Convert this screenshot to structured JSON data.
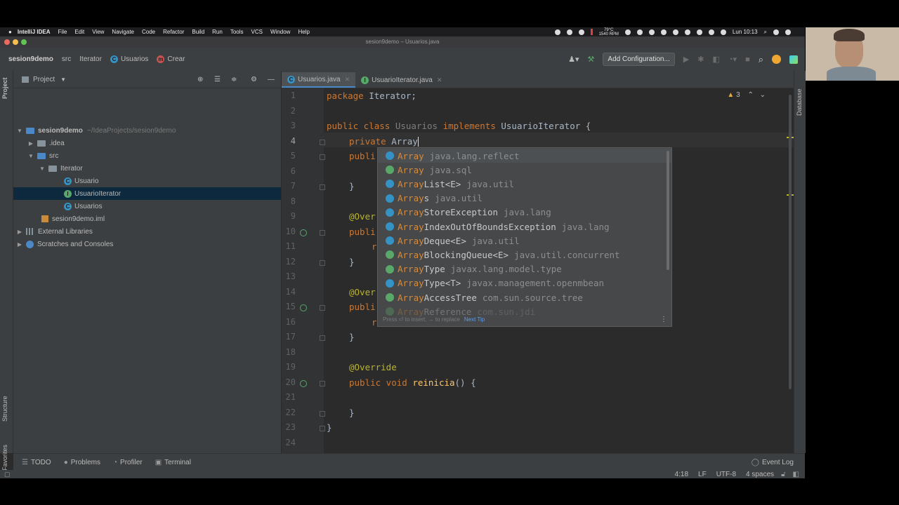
{
  "colors": {
    "background": "#2b2b2b",
    "accent": "#4a88c7",
    "selection": "#0d293e",
    "keyword": "#cc7832",
    "annotation": "#bbb529",
    "function": "#ffc66d"
  },
  "menubar": {
    "app": "IntelliJ IDEA",
    "items": [
      "File",
      "Edit",
      "View",
      "Navigate",
      "Code",
      "Refactor",
      "Build",
      "Run",
      "Tools",
      "VCS",
      "Window",
      "Help"
    ],
    "clock": "Lun 10:13",
    "weather": "79°C",
    "fan": "1540 RPM"
  },
  "window": {
    "title": "sesion9demo – Usuarios.java"
  },
  "navbar": {
    "project": "sesion9demo",
    "src": "src",
    "package": "Iterator",
    "class": "Usuarios",
    "method": "Crear",
    "add_configuration": "Add Configuration..."
  },
  "leftstrip": {
    "project": "Project",
    "structure": "Structure",
    "favorites": "Favorites"
  },
  "rightstrip": {
    "database": "Database"
  },
  "project_panel": {
    "title": "Project",
    "tree": [
      {
        "label": "sesion9demo",
        "extra": "~/IdeaProjects/sesion9demo"
      },
      {
        "label": ".idea",
        "extra": ""
      },
      {
        "label": "src",
        "extra": ""
      },
      {
        "label": "Iterator",
        "extra": ""
      },
      {
        "label": "Usuario",
        "extra": ""
      },
      {
        "label": "UsuarioIterator",
        "extra": ""
      },
      {
        "label": "Usuarios",
        "extra": ""
      },
      {
        "label": "sesion9demo.iml",
        "extra": ""
      },
      {
        "label": "External Libraries",
        "extra": ""
      },
      {
        "label": "Scratches and Consoles",
        "extra": ""
      }
    ]
  },
  "tabs": [
    {
      "label": "Usuarios.java",
      "active": true
    },
    {
      "label": "UsuarioIterator.java",
      "active": false
    }
  ],
  "editor": {
    "warning_count": "3",
    "line_numbers": [
      "1",
      "2",
      "3",
      "4",
      "5",
      "6",
      "7",
      "8",
      "9",
      "10",
      "11",
      "12",
      "13",
      "14",
      "15",
      "16",
      "17",
      "18",
      "19",
      "20",
      "21",
      "22",
      "23",
      "24"
    ],
    "code": {
      "l1_kw": "package",
      "l1_rest": " Iterator;",
      "l3_kw1": "public class ",
      "l3_name": "Usuarios",
      "l3_kw2": " implements ",
      "l3_rest": "UsuarioIterator {",
      "l4_kw": "private ",
      "l4_rest": "Array",
      "l5": "publi",
      "l7": "}",
      "l9": "@Over",
      "l10": "publi",
      "l11": "r",
      "l12": "}",
      "l14": "@Over",
      "l15": "publi",
      "l16": "r",
      "l17": "}",
      "l19": "@Override",
      "l20_kw": "public void ",
      "l20_fn": "reinicia",
      "l20_rest": "() {",
      "l22": "}",
      "l23": "}"
    }
  },
  "completion": {
    "items": [
      {
        "match": "Array",
        "rest": "",
        "pkg": "java.lang.reflect",
        "icon": "c"
      },
      {
        "match": "Array",
        "rest": "",
        "pkg": "java.sql",
        "icon": "i"
      },
      {
        "match": "Array",
        "rest": "List<E>",
        "pkg": "java.util",
        "icon": "c"
      },
      {
        "match": "Array",
        "rest": "s",
        "pkg": "java.util",
        "icon": "c"
      },
      {
        "match": "Array",
        "rest": "StoreException",
        "pkg": "java.lang",
        "icon": "c"
      },
      {
        "match": "Array",
        "rest": "IndexOutOfBoundsException",
        "pkg": "java.lang",
        "icon": "c"
      },
      {
        "match": "Array",
        "rest": "Deque<E>",
        "pkg": "java.util",
        "icon": "c"
      },
      {
        "match": "Array",
        "rest": "BlockingQueue<E>",
        "pkg": "java.util.concurrent",
        "icon": "i"
      },
      {
        "match": "Array",
        "rest": "Type",
        "pkg": "javax.lang.model.type",
        "icon": "i"
      },
      {
        "match": "Array",
        "rest": "Type<T>",
        "pkg": "javax.management.openmbean",
        "icon": "c"
      },
      {
        "match": "Array",
        "rest": "AccessTree",
        "pkg": "com.sun.source.tree",
        "icon": "i"
      },
      {
        "match": "Array",
        "rest": "Reference",
        "pkg": "com.sun.jdi",
        "icon": "i"
      }
    ],
    "footer": "Press ⏎ to insert, → to replace",
    "next_tip": "Next Tip"
  },
  "bottom_tools": [
    "TODO",
    "Problems",
    "Profiler",
    "Terminal"
  ],
  "event_log": "Event Log",
  "status": {
    "position": "4:18",
    "line_sep": "LF",
    "encoding": "UTF-8",
    "indent": "4 spaces"
  }
}
